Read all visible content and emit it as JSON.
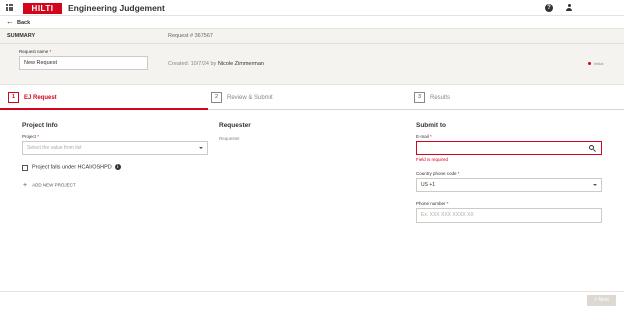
{
  "header": {
    "logo_text": "HILTI",
    "app_title": "Engineering Judgement",
    "help_icon": "help-icon",
    "user_icon": "user-icon",
    "apps_icon": "apps-grid-icon",
    "brand_color": "#d2051e"
  },
  "nav": {
    "back_label": "Back"
  },
  "summary": {
    "title": "SUMMARY",
    "request_number": "Request # 367567",
    "request_name_label": "Request name",
    "request_name_value": "New Request",
    "created_prefix": "Created: 10/7/24 by",
    "created_by": "Nicole Zimmerman",
    "status": "Initial"
  },
  "steps": [
    {
      "num": "1",
      "label": "EJ Request",
      "active": true
    },
    {
      "num": "2",
      "label": "Review & Submit",
      "active": false
    },
    {
      "num": "3",
      "label": "Results",
      "active": false
    }
  ],
  "project_info": {
    "title": "Project Info",
    "project_label": "Project",
    "project_placeholder": "Select the value from list",
    "checkbox_label": "Project falls under HCAI/OSHPD",
    "add_project_label": "ADD NEW PROJECT"
  },
  "requester": {
    "title": "Requester",
    "value": "Requester"
  },
  "submit_to": {
    "title": "Submit to",
    "email_label": "E-mail",
    "email_value": "",
    "email_error": "Field is required",
    "country_code_label": "Country phone code",
    "country_code_value": "US +1",
    "phone_label": "Phone number",
    "phone_placeholder": "Ex. XXX XXX XXXX XX"
  },
  "footer": {
    "next_label": "Next"
  }
}
